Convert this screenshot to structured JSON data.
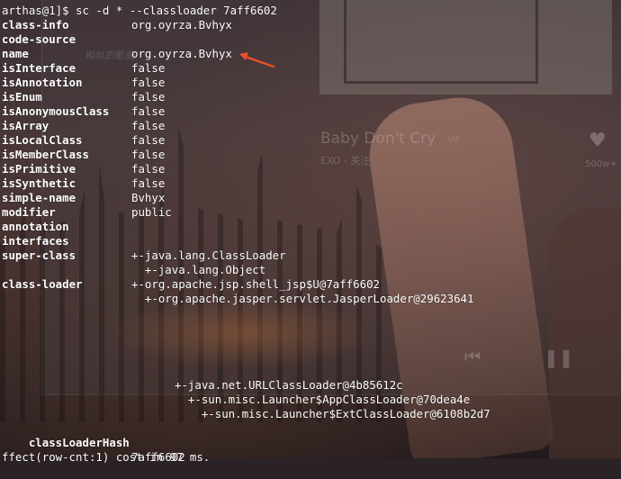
{
  "background": {
    "music_title": "Baby Don't Cry",
    "music_badge": "VIP",
    "music_artist": "EXO - 关注",
    "like_count": "500w+",
    "faded_tab_text": "相似的歌曲"
  },
  "terminal": {
    "command_line": "arthas@1]$ sc -d * --classloader 7aff6602",
    "rows": [
      {
        "key": "class-info",
        "value": "org.oyrza.Bvhyx"
      },
      {
        "key": "code-source",
        "value": ""
      },
      {
        "key": "name",
        "value": "org.oyrza.Bvhyx"
      },
      {
        "key": "isInterface",
        "value": "false"
      },
      {
        "key": "isAnnotation",
        "value": "false"
      },
      {
        "key": "isEnum",
        "value": "false"
      },
      {
        "key": "isAnonymousClass",
        "value": "false"
      },
      {
        "key": "isArray",
        "value": "false"
      },
      {
        "key": "isLocalClass",
        "value": "false"
      },
      {
        "key": "isMemberClass",
        "value": "false"
      },
      {
        "key": "isPrimitive",
        "value": "false"
      },
      {
        "key": "isSynthetic",
        "value": "false"
      },
      {
        "key": "simple-name",
        "value": "Bvhyx"
      },
      {
        "key": "modifier",
        "value": "public"
      },
      {
        "key": "annotation",
        "value": ""
      },
      {
        "key": "interfaces",
        "value": ""
      },
      {
        "key": "super-class",
        "value": "+-java.lang.ClassLoader"
      },
      {
        "key": "",
        "value": "  +-java.lang.Object"
      },
      {
        "key": "class-loader",
        "value": "+-org.apache.jsp.shell_jsp$U@7aff6602"
      },
      {
        "key": "",
        "value": "  +-org.apache.jasper.servlet.JasperLoader@29623641"
      }
    ],
    "loader_chain": [
      "+-java.net.URLClassLoader@4b85612c",
      "  +-sun.misc.Launcher$AppClassLoader@70dea4e",
      "    +-sun.misc.Launcher$ExtClassLoader@6108b2d7"
    ],
    "hash_key": "classLoaderHash",
    "hash_value": "7aff6602",
    "footer": "ffect(row-cnt:1) cost in 97 ms."
  },
  "colors": {
    "text": "#ffffff",
    "annotation_arrow": "#e8502a"
  }
}
